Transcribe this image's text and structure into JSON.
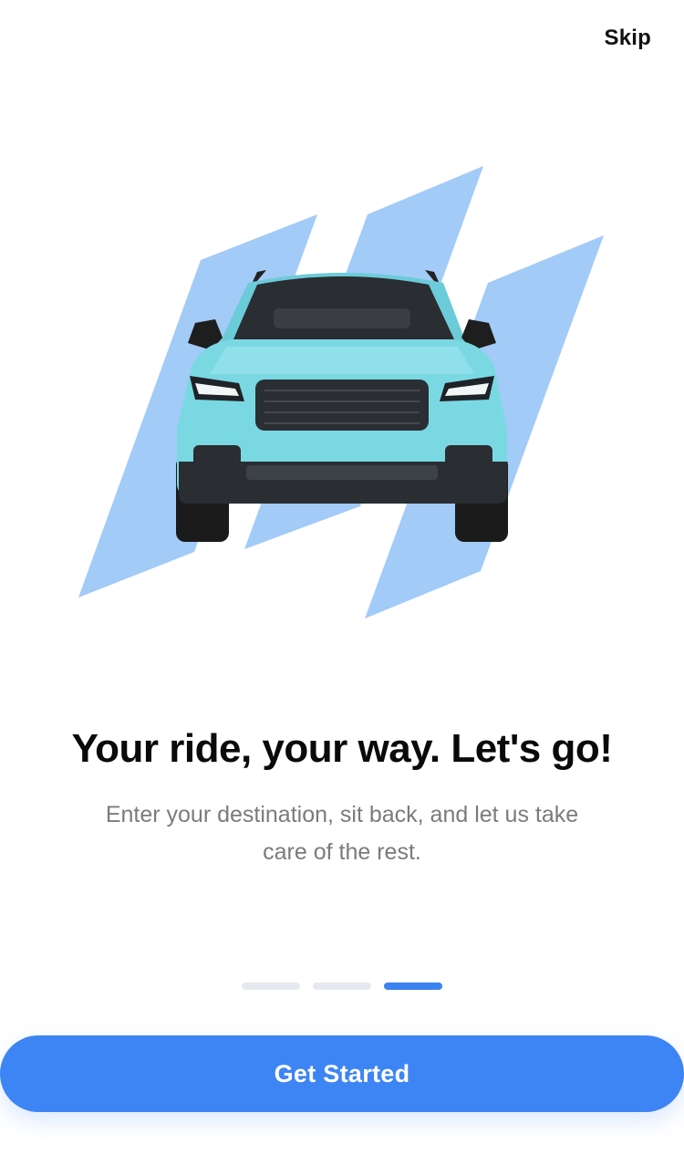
{
  "header": {
    "skip_label": "Skip"
  },
  "hero": {
    "image": "car-illustration",
    "accent_color": "#a3cbf7",
    "car_color": "#7ad8e3"
  },
  "content": {
    "title": "Your ride, your way. Let's go!",
    "subtitle": "Enter your destination, sit back, and let us take care of the rest."
  },
  "pagination": {
    "total": 3,
    "active": 3
  },
  "footer": {
    "cta_label": "Get Started",
    "cta_color": "#3d85f5"
  }
}
